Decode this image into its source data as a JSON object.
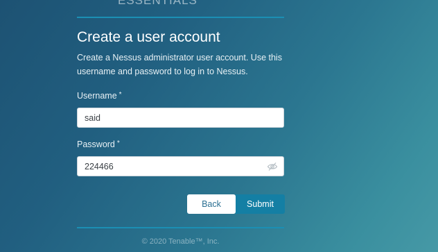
{
  "header": {
    "logo_text": "ESSENTIALS"
  },
  "form": {
    "title": "Create a user account",
    "description": "Create a Nessus administrator user account. Use this username and password to log in to Nessus.",
    "username": {
      "label": "Username",
      "required_marker": "*",
      "value": "said"
    },
    "password": {
      "label": "Password",
      "required_marker": "*",
      "value": "224466",
      "toggle_icon": "eye-slash-icon"
    },
    "buttons": {
      "back_label": "Back",
      "submit_label": "Submit"
    }
  },
  "footer": {
    "copyright": "© 2020 Tenable™, Inc."
  },
  "colors": {
    "accent": "#1b8fb4",
    "submit_bg": "#147fa4",
    "back_text": "#2a6f92"
  }
}
